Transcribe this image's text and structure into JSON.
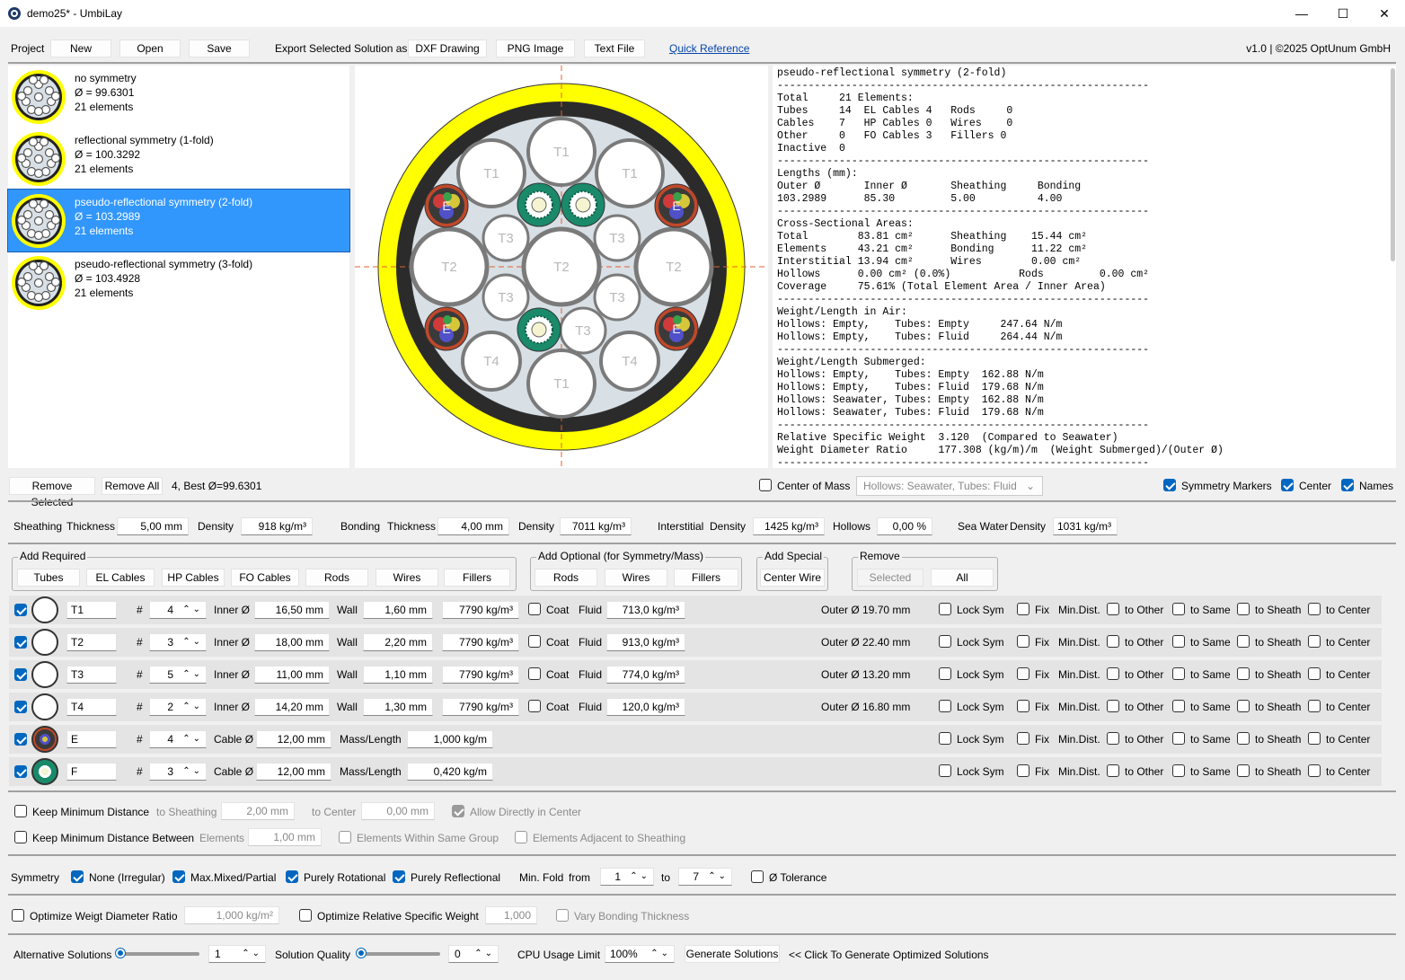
{
  "window": {
    "title": "demo25* - UmbiLay",
    "minimize": "—",
    "maximize": "☐",
    "close": "✕"
  },
  "menu": {
    "project_label": "Project",
    "new": "New",
    "open": "Open",
    "save": "Save",
    "export_label": "Export Selected Solution as",
    "dxf": "DXF Drawing",
    "png": "PNG Image",
    "text": "Text File",
    "quick_ref": "Quick Reference",
    "version": "v1.0 | ©2025 OptUnum GmbH"
  },
  "solutions": [
    {
      "name": "no symmetry",
      "diameter": "Ø = 99.6301",
      "elements": "21 elements",
      "selected": false
    },
    {
      "name": "reflectional symmetry (1-fold)",
      "diameter": "Ø = 100.3292",
      "elements": "21 elements",
      "selected": false
    },
    {
      "name": "pseudo-reflectional symmetry (2-fold)",
      "diameter": "Ø = 103.2989",
      "elements": "21 elements",
      "selected": true
    },
    {
      "name": "pseudo-reflectional symmetry (3-fold)",
      "diameter": "Ø = 103.4928",
      "elements": "21 elements",
      "selected": false
    }
  ],
  "drawing": {
    "labels": {
      "T1": "T1",
      "T2": "T2",
      "T3": "T3",
      "T4": "T4",
      "E": "E"
    },
    "colors": {
      "sheath": "#ffff00",
      "bonding": "#2b2b2b",
      "interstitial": "#d8e0e6",
      "tube_wall": "#7a7a7a",
      "fo": "#1a8a6a",
      "el": "#c0482a"
    }
  },
  "report_text": "pseudo-reflectional symmetry (2-fold)\n------------------------------------------------------------\nTotal     21 Elements:\nTubes     14  EL Cables 4   Rods     0\nCables    7   HP Cables 0   Wires    0\nOther     0   FO Cables 3   Fillers 0\nInactive  0\n------------------------------------------------------------\nLengths (mm):\nOuter Ø       Inner Ø       Sheathing     Bonding\n103.2989      85.30         5.00          4.00\n------------------------------------------------------------\nCross-Sectional Areas:\nTotal        83.81 cm²      Sheathing    15.44 cm²\nElements     43.21 cm²      Bonding      11.22 cm²\nInterstitial 13.94 cm²      Wires        0.00 cm²\nHollows      0.00 cm² (0.0%)           Rods         0.00 cm²\nCoverage     75.61% (Total Element Area / Inner Area)\n------------------------------------------------------------\nWeight/Length in Air:\nHollows: Empty,    Tubes: Empty     247.64 N/m\nHollows: Empty,    Tubes: Fluid     264.44 N/m\n------------------------------------------------------------\nWeight/Length Submerged:\nHollows: Empty,    Tubes: Empty  162.88 N/m\nHollows: Empty,    Tubes: Fluid  179.68 N/m\nHollows: Seawater, Tubes: Empty  162.88 N/m\nHollows: Seawater, Tubes: Fluid  179.68 N/m\n------------------------------------------------------------\nRelative Specific Weight  3.120  (Compared to Seawater)\nWeight Diameter Ratio     177.308 (kg/m)/m  (Weight Submerged)/(Outer Ø)\n------------------------------------------------------------",
  "list_bar": {
    "remove_selected": "Remove Selected",
    "remove_all": "Remove All",
    "status": "4, Best Ø=99.6301",
    "center_of_mass": "Center of Mass",
    "hollows_combo": "Hollows: Seawater, Tubes: Fluid",
    "symmetry_markers": "Symmetry Markers",
    "center": "Center",
    "names": "Names"
  },
  "props": {
    "sheathing": "Sheathing",
    "thickness": "Thickness",
    "sheath_thickness": "5,00 mm",
    "density": "Density",
    "sheath_density": "918 kg/m³",
    "bonding": "Bonding",
    "bond_thickness": "4,00 mm",
    "bond_density": "7011 kg/m³",
    "interstitial": "Interstitial",
    "inter_density": "1425 kg/m³",
    "hollows": "Hollows",
    "hollows_value": "0,00 %",
    "sea_water": "Sea Water",
    "sea_density": "1031 kg/m³"
  },
  "add": {
    "required_title": "Add Required",
    "required": [
      "Tubes",
      "EL Cables",
      "HP Cables",
      "FO Cables",
      "Rods",
      "Wires",
      "Fillers"
    ],
    "optional_title": "Add Optional (for Symmetry/Mass)",
    "optional": [
      "Rods",
      "Wires",
      "Fillers"
    ],
    "special_title": "Add Special",
    "special": "Center Wire",
    "remove_title": "Remove",
    "remove_selected": "Selected",
    "remove_all": "All"
  },
  "elements": [
    {
      "name": "T1",
      "count": "4",
      "kind": "tube",
      "inner": "16,50 mm",
      "wall": "1,60 mm",
      "density": "7790 kg/m³",
      "fluid": "713,0 kg/m³",
      "outer": "Outer Ø 19.70 mm"
    },
    {
      "name": "T2",
      "count": "3",
      "kind": "tube",
      "inner": "18,00 mm",
      "wall": "2,20 mm",
      "density": "7790 kg/m³",
      "fluid": "913,0 kg/m³",
      "outer": "Outer Ø 22.40 mm"
    },
    {
      "name": "T3",
      "count": "5",
      "kind": "tube",
      "inner": "11,00 mm",
      "wall": "1,10 mm",
      "density": "7790 kg/m³",
      "fluid": "774,0 kg/m³",
      "outer": "Outer Ø 13.20 mm"
    },
    {
      "name": "T4",
      "count": "2",
      "kind": "tube",
      "inner": "14,20 mm",
      "wall": "1,30 mm",
      "density": "7790 kg/m³",
      "fluid": "120,0 kg/m³",
      "outer": "Outer Ø 16.80 mm"
    },
    {
      "name": "E",
      "count": "4",
      "kind": "cable",
      "cable": "12,00 mm",
      "mass": "1,000 kg/m"
    },
    {
      "name": "F",
      "count": "3",
      "kind": "cable",
      "cable": "12,00 mm",
      "mass": "0,420 kg/m"
    }
  ],
  "row_labels": {
    "hash": "#",
    "inner": "Inner Ø",
    "wall": "Wall",
    "coat": "Coat",
    "fluid": "Fluid",
    "cable": "Cable Ø",
    "mass": "Mass/Length",
    "lock_sym": "Lock Sym",
    "fix": "Fix",
    "min_dist": "Min.Dist.",
    "to_other": "to Other",
    "to_same": "to Same",
    "to_sheath": "to Sheath",
    "to_center": "to Center"
  },
  "distance": {
    "keep_min": "Keep Minimum Distance",
    "to_sheathing": "to Sheathing",
    "sheath_val": "2,00 mm",
    "to_center": "to Center",
    "center_val": "0,00 mm",
    "allow_center": "Allow Directly in Center",
    "keep_between": "Keep Minimum Distance Between",
    "elements": "Elements",
    "elements_val": "1,00 mm",
    "within_group": "Elements Within Same Group",
    "adjacent": "Elements Adjacent to Sheathing"
  },
  "symmetry": {
    "label": "Symmetry",
    "none": "None (Irregular)",
    "mixed": "Max.Mixed/Partial",
    "rotational": "Purely Rotational",
    "reflectional": "Purely Reflectional",
    "min_fold": "Min. Fold",
    "from": "from",
    "from_val": "1",
    "to": "to",
    "to_val": "7",
    "tolerance": "Ø Tolerance"
  },
  "optimize": {
    "wdr": "Optimize Weigt Diameter Ratio",
    "wdr_val": "1,000 kg/m²",
    "rsw": "Optimize Relative Specific Weight",
    "rsw_val": "1,000",
    "vary": "Vary Bonding Thickness"
  },
  "bottom": {
    "alt": "Alternative Solutions",
    "alt_val": "1",
    "quality": "Solution Quality",
    "quality_val": "0",
    "cpu": "CPU Usage Limit",
    "cpu_val": "100%",
    "generate": "Generate Solutions",
    "hint": "<< Click To Generate Optimized Solutions"
  }
}
